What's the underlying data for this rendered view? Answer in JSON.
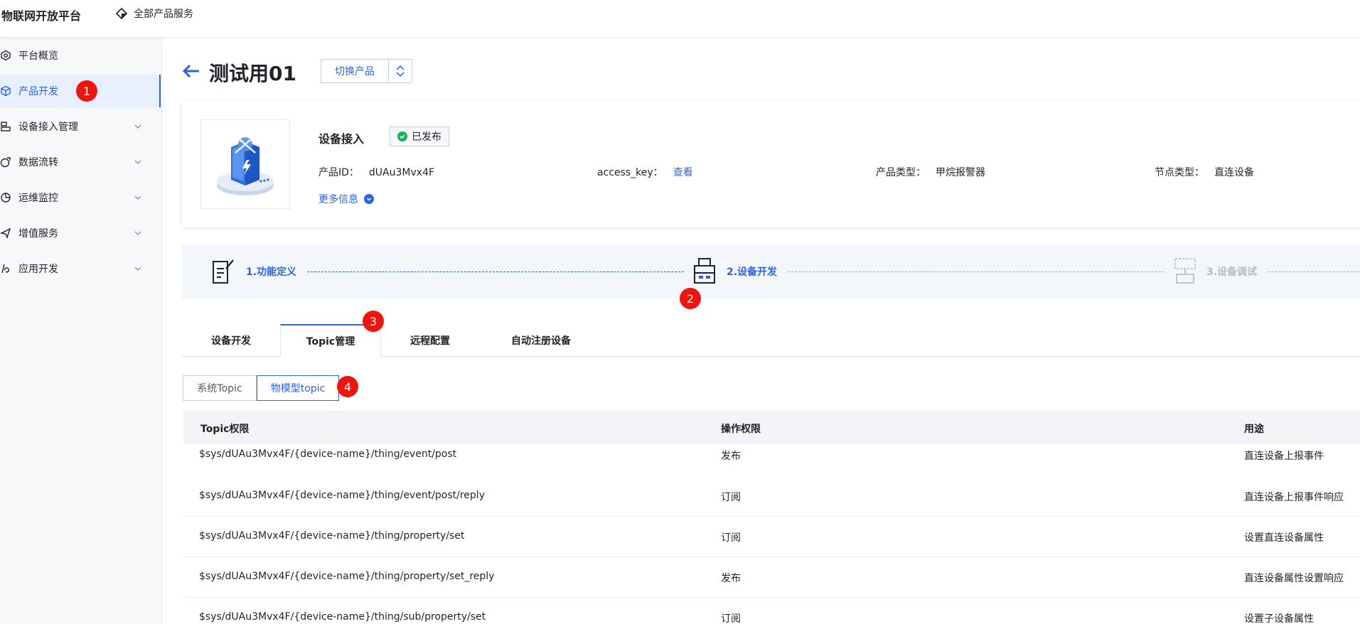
{
  "topbar": {
    "brand": "物联网开放平台",
    "all_products": "全部产品服务"
  },
  "sidebar": {
    "items": [
      {
        "label": "平台概览",
        "icon": "overview-icon",
        "active": false,
        "expandable": false
      },
      {
        "label": "产品开发",
        "icon": "cube-icon",
        "active": true,
        "expandable": false
      },
      {
        "label": "设备接入管理",
        "icon": "device-access-icon",
        "active": false,
        "expandable": true
      },
      {
        "label": "数据流转",
        "icon": "data-flow-icon",
        "active": false,
        "expandable": true
      },
      {
        "label": "运维监控",
        "icon": "monitor-icon",
        "active": false,
        "expandable": true
      },
      {
        "label": "增值服务",
        "icon": "send-icon",
        "active": false,
        "expandable": true
      },
      {
        "label": "应用开发",
        "icon": "app-dev-icon",
        "active": false,
        "expandable": true
      }
    ]
  },
  "annotations": [
    "1",
    "2",
    "3",
    "4"
  ],
  "header": {
    "title": "测试用01",
    "switch_label": "切换产品"
  },
  "product": {
    "name": "设备接入",
    "status": "已发布",
    "fields": [
      {
        "label": "产品ID：",
        "value": "dUAu3Mvx4F",
        "link": false
      },
      {
        "label": "access_key：",
        "value": "查看",
        "link": true
      },
      {
        "label": "产品类型：",
        "value": "甲烷报警器",
        "link": false
      },
      {
        "label": "节点类型：",
        "value": "直连设备",
        "link": false
      }
    ],
    "more_info": "更多信息"
  },
  "steps": [
    {
      "label": "1.功能定义",
      "state": "done"
    },
    {
      "label": "2.设备开发",
      "state": "current"
    },
    {
      "label": "3.设备调试",
      "state": "pending"
    }
  ],
  "tabs": [
    "设备开发",
    "Topic管理",
    "远程配置",
    "自动注册设备"
  ],
  "active_tab": "Topic管理",
  "subtabs": [
    "系统Topic",
    "物模型topic"
  ],
  "active_subtab": "物模型topic",
  "table": {
    "columns": [
      "Topic权限",
      "操作权限",
      "用途"
    ],
    "rows": [
      [
        "$sys/dUAu3Mvx4F/{device-name}/thing/event/post",
        "发布",
        "直连设备上报事件"
      ],
      [
        "$sys/dUAu3Mvx4F/{device-name}/thing/event/post/reply",
        "订阅",
        "直连设备上报事件响应"
      ],
      [
        "$sys/dUAu3Mvx4F/{device-name}/thing/property/set",
        "订阅",
        "设置直连设备属性"
      ],
      [
        "$sys/dUAu3Mvx4F/{device-name}/thing/property/set_reply",
        "发布",
        "直连设备属性设置响应"
      ],
      [
        "$sys/dUAu3Mvx4F/{device-name}/thing/sub/property/set",
        "订阅",
        "设置子设备属性"
      ]
    ]
  },
  "colors": {
    "accent": "#2b62ea",
    "badge": "#f0140f",
    "published": "#14b25c"
  }
}
